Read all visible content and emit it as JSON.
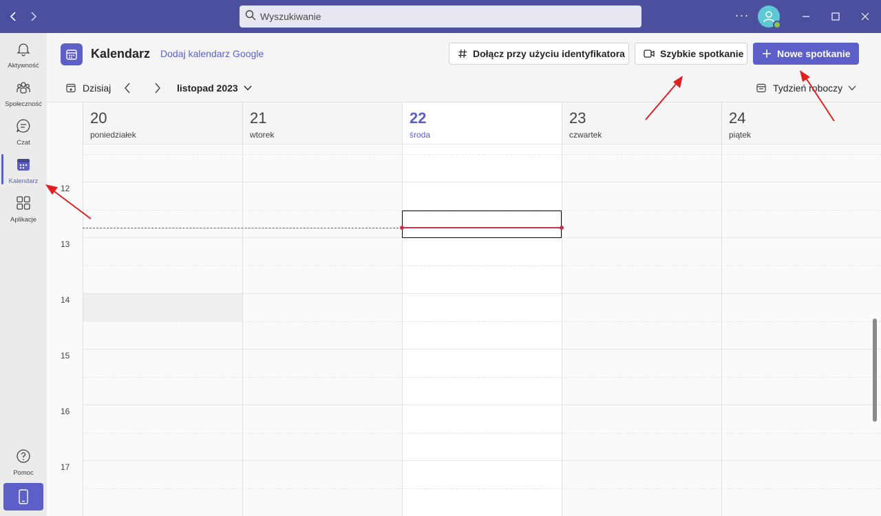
{
  "titlebar": {
    "search_placeholder": "Wyszukiwanie"
  },
  "rail": {
    "items": [
      {
        "label": "Aktywność",
        "icon": "bell-icon"
      },
      {
        "label": "Społeczność",
        "icon": "community-icon"
      },
      {
        "label": "Czat",
        "icon": "chat-icon"
      },
      {
        "label": "Kalendarz",
        "icon": "calendar-icon",
        "active": true
      },
      {
        "label": "Aplikacje",
        "icon": "apps-icon"
      }
    ],
    "help_label": "Pomoc"
  },
  "header": {
    "title": "Kalendarz",
    "google_link": "Dodaj kalendarz Google",
    "join_button": "Dołącz przy użyciu identyfikatora",
    "quick_meeting_button": "Szybkie spotkanie",
    "new_meeting_button": "Nowe spotkanie"
  },
  "toolbar": {
    "today": "Dzisiaj",
    "month": "listopad 2023",
    "view": "Tydzień roboczy"
  },
  "days": [
    {
      "num": "20",
      "name": "poniedziałek"
    },
    {
      "num": "21",
      "name": "wtorek"
    },
    {
      "num": "22",
      "name": "środa",
      "today": true
    },
    {
      "num": "23",
      "name": "czwartek"
    },
    {
      "num": "24",
      "name": "piątek"
    }
  ],
  "hours": [
    "12",
    "13",
    "14",
    "15",
    "16",
    "17"
  ],
  "colors": {
    "titlebar": "#4b4f9e",
    "accent": "#5b5fc7",
    "now_line": "#c4314b",
    "annotation_arrow": "#e02020"
  }
}
